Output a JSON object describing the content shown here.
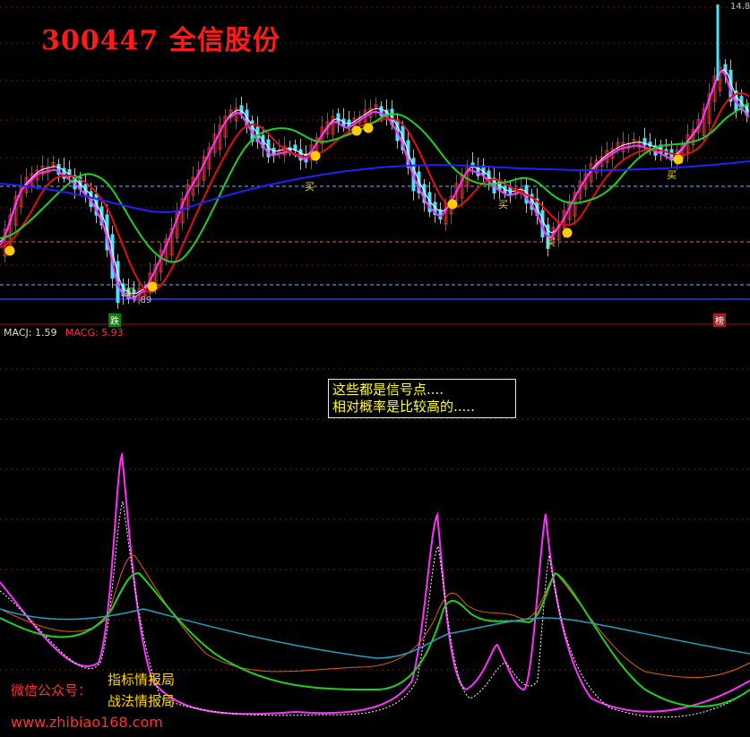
{
  "title": "300447 全信股份",
  "price_panel": {
    "top_value": "14.8",
    "low_value": "7.89",
    "buy_label": "买",
    "badge_down": "跌",
    "badge_list": "榜"
  },
  "indicator": {
    "name1": "MACJ:",
    "value1": "1.59",
    "name2": "MACG:",
    "value2": "5.93"
  },
  "note": {
    "line1": "这些都是信号点....",
    "line2": "相对概率是比较高的....."
  },
  "watermark": {
    "wechat": "微信公众号：",
    "account1": "指标情报局",
    "account2": "战法情报局",
    "site": "www.zhibiao168.com"
  },
  "colors": {
    "background": "#000000",
    "up_candle": "#ff2020",
    "down_candle": "#50e0ff",
    "line_white": "#ffffff",
    "line_red": "#e01010",
    "line_green": "#20d020",
    "line_blue": "#2020ff",
    "line_magenta": "#ff30ff",
    "signal_dot": "#ffcc00",
    "title": "#ff1a1a",
    "note_text": "#ffff33"
  }
}
